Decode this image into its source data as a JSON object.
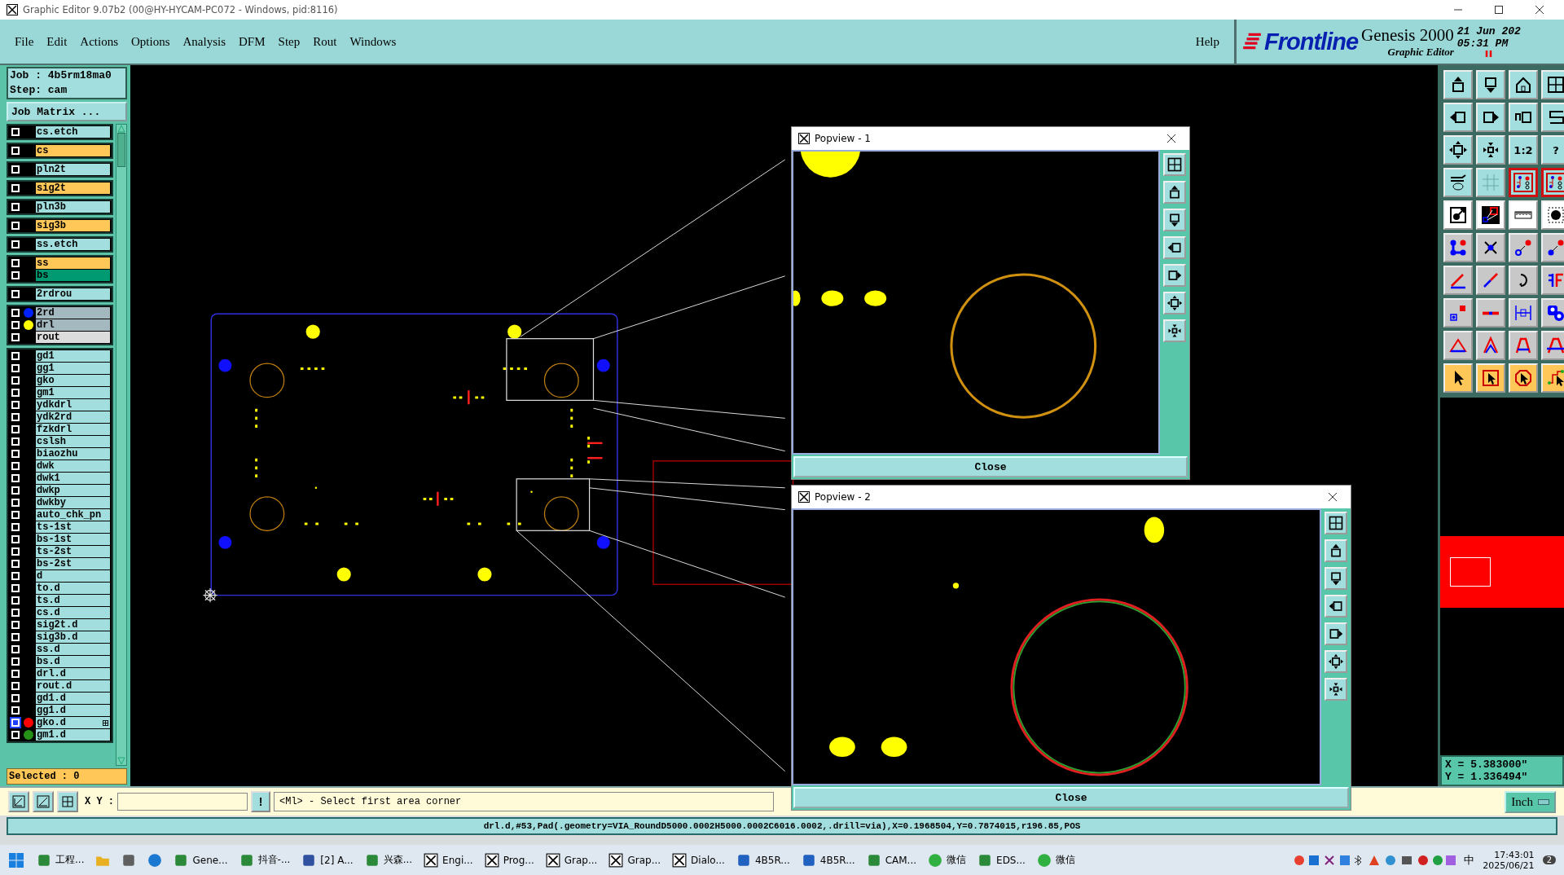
{
  "window": {
    "title": "Graphic Editor 9.07b2 (00@HY-HYCAM-PC072 - Windows, pid:8116)"
  },
  "menu": [
    "File",
    "Edit",
    "Actions",
    "Options",
    "Analysis",
    "DFM",
    "Step",
    "Rout",
    "Windows"
  ],
  "help": "Help",
  "brand": {
    "logo": "Frontline",
    "product": "Genesis 2000",
    "subtitle": "Graphic Editor",
    "date": "21 Jun 202",
    "time": "05:31 PM"
  },
  "job": {
    "job": "Job : 4b5rm18ma0",
    "step": "Step: cam",
    "matrix_button": "Job Matrix ..."
  },
  "layer_groups": [
    {
      "layers": [
        {
          "name": "cs.etch",
          "kind": "misc",
          "selected": false
        }
      ]
    },
    {
      "layers": [
        {
          "name": "cs",
          "kind": "signal",
          "selected": false
        }
      ]
    },
    {
      "layers": [
        {
          "name": "pln2t",
          "kind": "misc",
          "selected": false
        }
      ]
    },
    {
      "layers": [
        {
          "name": "sig2t",
          "kind": "signal",
          "selected": false
        }
      ]
    },
    {
      "layers": [
        {
          "name": "pln3b",
          "kind": "misc",
          "selected": false
        }
      ]
    },
    {
      "layers": [
        {
          "name": "sig3b",
          "kind": "signal",
          "selected": false
        }
      ]
    },
    {
      "layers": [
        {
          "name": "ss.etch",
          "kind": "misc",
          "selected": false
        }
      ]
    },
    {
      "layers": [
        {
          "name": "ss",
          "kind": "signal",
          "selected": false
        },
        {
          "name": "bs",
          "kind": "mask",
          "selected": false
        }
      ]
    },
    {
      "layers": [
        {
          "name": "2rdrou",
          "kind": "misc",
          "selected": false
        }
      ]
    },
    {
      "layers": [
        {
          "name": "2rd",
          "kind": "drill",
          "selected": false,
          "color": "#0020ff"
        },
        {
          "name": "drl",
          "kind": "drill",
          "selected": false,
          "color": "#ffff00"
        },
        {
          "name": "rout",
          "kind": "rout",
          "selected": false
        }
      ]
    },
    {
      "layers": [
        {
          "name": "gd1",
          "kind": "misc",
          "selected": false
        },
        {
          "name": "gg1",
          "kind": "misc",
          "selected": false
        },
        {
          "name": "gko",
          "kind": "misc",
          "selected": false
        },
        {
          "name": "gm1",
          "kind": "misc",
          "selected": false
        },
        {
          "name": "ydkdrl",
          "kind": "misc",
          "selected": false
        },
        {
          "name": "ydk2rd",
          "kind": "misc",
          "selected": false
        },
        {
          "name": "fzkdrl",
          "kind": "misc",
          "selected": false
        },
        {
          "name": "cslsh",
          "kind": "misc",
          "selected": false
        },
        {
          "name": "biaozhu",
          "kind": "misc",
          "selected": false
        },
        {
          "name": "dwk",
          "kind": "misc",
          "selected": false
        },
        {
          "name": "dwk1",
          "kind": "misc",
          "selected": false
        },
        {
          "name": "dwkp",
          "kind": "misc",
          "selected": false
        },
        {
          "name": "dwkby",
          "kind": "misc",
          "selected": false
        },
        {
          "name": "auto_chk_pn",
          "kind": "misc",
          "selected": false
        },
        {
          "name": "ts-1st",
          "kind": "misc",
          "selected": false
        },
        {
          "name": "bs-1st",
          "kind": "misc",
          "selected": false
        },
        {
          "name": "ts-2st",
          "kind": "misc",
          "selected": false
        },
        {
          "name": "bs-2st",
          "kind": "misc",
          "selected": false
        },
        {
          "name": "d",
          "kind": "misc",
          "selected": false
        },
        {
          "name": "to.d",
          "kind": "misc",
          "selected": false
        },
        {
          "name": "ts.d",
          "kind": "misc",
          "selected": false
        },
        {
          "name": "cs.d",
          "kind": "misc",
          "selected": false
        },
        {
          "name": "sig2t.d",
          "kind": "misc",
          "selected": false
        },
        {
          "name": "sig3b.d",
          "kind": "misc",
          "selected": false
        },
        {
          "name": "ss.d",
          "kind": "misc",
          "selected": false
        },
        {
          "name": "bs.d",
          "kind": "misc",
          "selected": false
        },
        {
          "name": "drl.d",
          "kind": "misc",
          "selected": false
        },
        {
          "name": "rout.d",
          "kind": "misc",
          "selected": false
        },
        {
          "name": "gd1.d",
          "kind": "misc",
          "selected": false
        },
        {
          "name": "gg1.d",
          "kind": "misc",
          "selected": false
        },
        {
          "name": "gko.d",
          "kind": "misc",
          "selected": true,
          "color": "#ff0000",
          "marker": true
        },
        {
          "name": "gm1.d",
          "kind": "misc",
          "selected": false,
          "color": "#249016"
        }
      ]
    }
  ],
  "selected_count": "Selected : 0",
  "tools": [
    {
      "kind": "box-up",
      "on": false
    },
    {
      "kind": "box-down",
      "on": false
    },
    {
      "kind": "house",
      "on": false
    },
    {
      "kind": "window-grid",
      "on": false
    },
    {
      "kind": "box-left",
      "on": false
    },
    {
      "kind": "box-right",
      "on": false
    },
    {
      "kind": "undo-box",
      "on": false
    },
    {
      "kind": "zigzag",
      "on": false
    },
    {
      "kind": "expand",
      "on": false
    },
    {
      "kind": "shrink",
      "on": false
    },
    {
      "kind": "label",
      "label": "1:2",
      "on": false
    },
    {
      "kind": "label",
      "label": "?",
      "on": false
    },
    {
      "kind": "wrench",
      "on": false
    },
    {
      "kind": "grid",
      "on": false
    },
    {
      "kind": "circuit",
      "on": true
    },
    {
      "kind": "circuit",
      "on": true
    },
    {
      "kind": "pad-arrow",
      "on": false
    },
    {
      "kind": "diagonal-squares",
      "on": false
    },
    {
      "kind": "ruler",
      "on": false
    },
    {
      "kind": "dotted-pad",
      "on": false
    },
    {
      "kind": "nodes",
      "on": false
    },
    {
      "kind": "cross",
      "on": false
    },
    {
      "kind": "circle-link",
      "on": false
    },
    {
      "kind": "dot-link",
      "on": false
    },
    {
      "kind": "angle-line",
      "on": false
    },
    {
      "kind": "diagonal-line",
      "on": false
    },
    {
      "kind": "curved-arrow",
      "on": false
    },
    {
      "kind": "split-bars",
      "on": false
    },
    {
      "kind": "square-link",
      "on": false
    },
    {
      "kind": "dash-line",
      "on": false
    },
    {
      "kind": "measure",
      "on": false
    },
    {
      "kind": "blobs",
      "on": false
    },
    {
      "kind": "triangle",
      "on": false
    },
    {
      "kind": "chevron",
      "on": false
    },
    {
      "kind": "arch",
      "on": false
    },
    {
      "kind": "arch-line",
      "on": false
    },
    {
      "kind": "cursor",
      "on": false
    },
    {
      "kind": "cursor-box",
      "on": false
    },
    {
      "kind": "cursor-octagon",
      "on": false
    },
    {
      "kind": "cursor-route",
      "on": false
    }
  ],
  "coordinates": {
    "x": "X = 5.383000\"",
    "y": "Y = 1.336494\""
  },
  "popviews": [
    {
      "title": "Popview - 1",
      "close": "Close",
      "kind": "single",
      "tools": [
        {
          "kind": "frame"
        },
        {
          "kind": "box-up"
        },
        {
          "kind": "box-down"
        },
        {
          "kind": "box-left"
        },
        {
          "kind": "box-right"
        },
        {
          "kind": "expand"
        },
        {
          "kind": "shrink"
        }
      ]
    },
    {
      "title": "Popview - 2",
      "close": "Close",
      "kind": "double",
      "tools": [
        {
          "kind": "frame"
        },
        {
          "kind": "box-up"
        },
        {
          "kind": "box-down"
        },
        {
          "kind": "box-left"
        },
        {
          "kind": "box-right"
        },
        {
          "kind": "expand"
        },
        {
          "kind": "shrink"
        }
      ]
    }
  ],
  "bottom_bar": {
    "xy_label": "X Y :",
    "alert": "!",
    "prompt": "<Ml> - Select first area corner",
    "units": "Inch"
  },
  "status_bar": "drl.d,#53,Pad(.geometry=VIA_RoundD5000.0002H5000.0002C6016.0002,.drill=via),X=0.1968504,Y=0.7874015,r196.85,POS",
  "taskbar": {
    "items": [
      {
        "label": "工程...",
        "kind": "app"
      },
      {
        "kind": "folder"
      },
      {
        "kind": "calculator"
      },
      {
        "kind": "browser"
      },
      {
        "label": "Gene...",
        "kind": "app"
      },
      {
        "label": "抖音-...",
        "kind": "app"
      },
      {
        "label": "[2] A...",
        "kind": "disk"
      },
      {
        "label": "兴森...",
        "kind": "app"
      },
      {
        "label": "Engi...",
        "kind": "window"
      },
      {
        "label": "Prog...",
        "kind": "window"
      },
      {
        "label": "Grap...",
        "kind": "window"
      },
      {
        "label": "Grap...",
        "kind": "window"
      },
      {
        "label": "Dialo...",
        "kind": "window"
      },
      {
        "label": "4B5R...",
        "kind": "document"
      },
      {
        "label": "4B5R...",
        "kind": "document"
      },
      {
        "label": "CAM...",
        "kind": "app"
      },
      {
        "label": "微信",
        "kind": "chat"
      },
      {
        "label": "EDS...",
        "kind": "app"
      },
      {
        "label": "微信",
        "kind": "chat"
      }
    ],
    "ime": "中",
    "time": "17:43:01",
    "date": "2025/06/21",
    "badge": "2"
  }
}
